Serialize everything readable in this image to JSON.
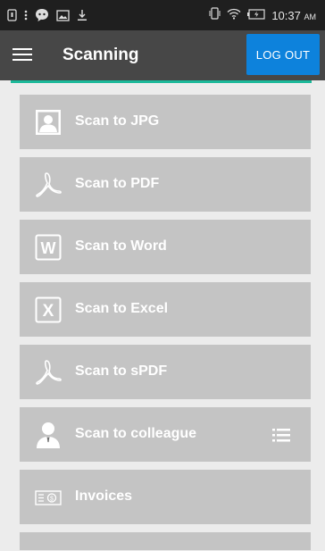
{
  "status_bar": {
    "time": "10:37",
    "ampm": "AM",
    "icons": [
      "notification-icon",
      "more-icon",
      "chat-icon",
      "gallery-icon",
      "download-icon",
      "vibrate-icon",
      "wifi-icon",
      "battery-icon"
    ]
  },
  "app_bar": {
    "title": "Scanning",
    "logout_label": "LOG OUT",
    "menu_icon": "hamburger-icon"
  },
  "colors": {
    "app_bar": "#474747",
    "logout": "#0d82dc",
    "accent": "#1db99a",
    "row_bg": "#c4c4c4",
    "page_bg": "#ececec"
  },
  "items": [
    {
      "label": "Scan to JPG",
      "icon": "image-person-icon"
    },
    {
      "label": "Scan to PDF",
      "icon": "pdf-icon"
    },
    {
      "label": "Scan to Word",
      "icon": "word-icon"
    },
    {
      "label": "Scan to Excel",
      "icon": "excel-icon"
    },
    {
      "label": "Scan to sPDF",
      "icon": "pdf-icon"
    },
    {
      "label": "Scan to colleague",
      "icon": "person-icon",
      "trailing_icon": "list-icon"
    },
    {
      "label": "Invoices",
      "icon": "invoice-icon"
    }
  ]
}
